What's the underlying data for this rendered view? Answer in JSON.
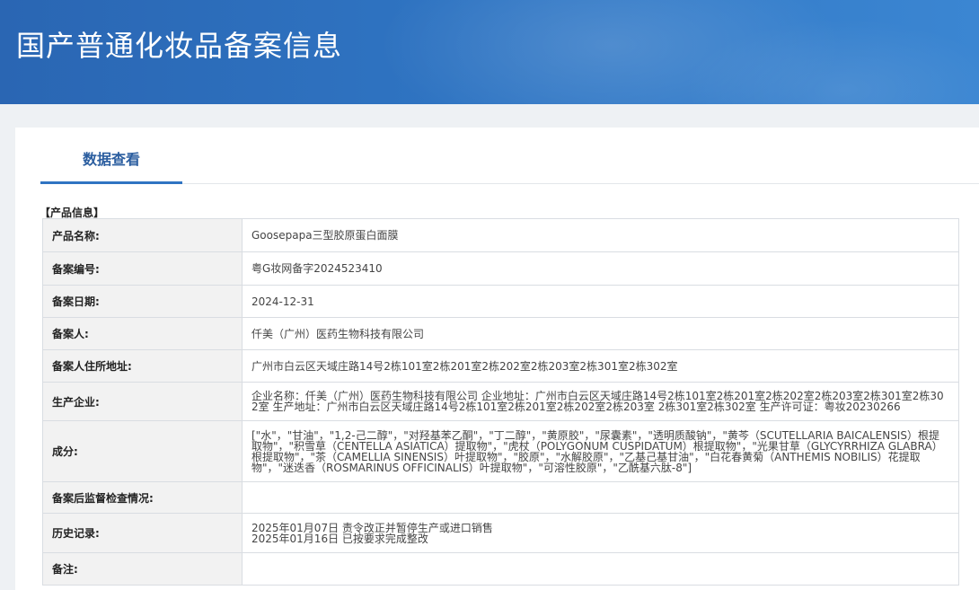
{
  "header": {
    "title": "国产普通化妆品备案信息"
  },
  "tabs": [
    {
      "label": "数据查看",
      "active": true
    }
  ],
  "section": {
    "title": "【产品信息】"
  },
  "rows": [
    {
      "label": "产品名称:",
      "value": "Goosepapa三型胶原蛋白面膜"
    },
    {
      "label": "备案编号:",
      "value": "粤G妆网备字2024523410"
    },
    {
      "label": "备案日期:",
      "value": "2024-12-31"
    },
    {
      "label": "备案人:",
      "value": "仟美（广州）医药生物科技有限公司"
    },
    {
      "label": "备案人住所地址:",
      "value": "广州市白云区天域庄路14号2栋101室2栋201室2栋202室2栋203室2栋301室2栋302室"
    },
    {
      "label": "生产企业:",
      "value": "企业名称：仟美（广州）医药生物科技有限公司 企业地址：广州市白云区天域庄路14号2栋101室2栋201室2栋202室2栋203室2栋301室2栋302室 生产地址：广州市白云区天域庄路14号2栋101室2栋201室2栋202室2栋203室 2栋301室2栋302室 生产许可证：粤妆20230266"
    },
    {
      "label": "成分:",
      "value": "[\"水\"，\"甘油\"，\"1,2-己二醇\"，\"对羟基苯乙酮\"，\"丁二醇\"，\"黄原胶\"，\"尿囊素\"，\"透明质酸钠\"，\"黄芩（SCUTELLARIA BAICALENSIS）根提取物\"，\"积雪草（CENTELLA ASIATICA）提取物\"，\"虎杖（POLYGONUM CUSPIDATUM）根提取物\"，\"光果甘草（GLYCYRRHIZA GLABRA）根提取物\"，\"茶（CAMELLIA SINENSIS）叶提取物\"，\"胶原\"，\"水解胶原\"，\"乙基己基甘油\"，\"白花春黄菊（ANTHEMIS NOBILIS）花提取物\"，\"迷迭香（ROSMARINUS OFFICINALIS）叶提取物\"，\"可溶性胶原\"，\"乙酰基六肽-8\"]"
    },
    {
      "label": "备案后监督检查情况:",
      "value": ""
    },
    {
      "label": "历史记录:",
      "value": "2025年01月07日 责令改正并暂停生产或进口销售\n2025年01月16日 已按要求完成整改"
    },
    {
      "label": "备注:",
      "value": ""
    }
  ]
}
